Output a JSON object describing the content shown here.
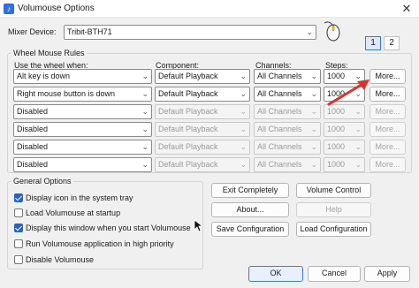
{
  "window": {
    "title": "Volumouse Options",
    "close_glyph": "✕"
  },
  "mixer": {
    "label": "Mixer Device:",
    "value": "Tribit-BTH71"
  },
  "tabs": [
    "1",
    "2"
  ],
  "wheel_rules": {
    "title": "Wheel Mouse Rules",
    "headers": {
      "wheel": "Use the wheel when:",
      "component": "Component:",
      "channels": "Channels:",
      "steps": "Steps:"
    },
    "rows": [
      {
        "wheel": "Alt key is down",
        "component": "Default Playback",
        "channels": "All Channels",
        "steps": "1000",
        "more": "More...",
        "enabled": true
      },
      {
        "wheel": "Right mouse button is down",
        "component": "Default Playback",
        "channels": "All Channels",
        "steps": "1000",
        "more": "More...",
        "enabled": true
      },
      {
        "wheel": "Disabled",
        "component": "Default Playback",
        "channels": "All Channels",
        "steps": "1000",
        "more": "More...",
        "enabled": false
      },
      {
        "wheel": "Disabled",
        "component": "Default Playback",
        "channels": "All Channels",
        "steps": "1000",
        "more": "More...",
        "enabled": false
      },
      {
        "wheel": "Disabled",
        "component": "Default Playback",
        "channels": "All Channels",
        "steps": "1000",
        "more": "More...",
        "enabled": false
      },
      {
        "wheel": "Disabled",
        "component": "Default Playback",
        "channels": "All Channels",
        "steps": "1000",
        "more": "More...",
        "enabled": false
      }
    ]
  },
  "general": {
    "title": "General Options",
    "options": [
      {
        "label": "Display icon in the system tray",
        "checked": true
      },
      {
        "label": "Load Volumouse at startup",
        "checked": false
      },
      {
        "label": "Display this window when you start Volumouse",
        "checked": true
      },
      {
        "label": "Run Volumouse application in high priority",
        "checked": false
      },
      {
        "label": "Disable Volumouse",
        "checked": false
      }
    ]
  },
  "actions": {
    "exit": "Exit Completely",
    "volume_control": "Volume Control",
    "about": "About...",
    "help": "Help",
    "save_config": "Save Configuration",
    "load_config": "Load Configuration"
  },
  "footer": {
    "ok": "OK",
    "cancel": "Cancel",
    "apply": "Apply"
  },
  "colors": {
    "accent": "#2563c9",
    "annotation_arrow": "#d9342b"
  }
}
